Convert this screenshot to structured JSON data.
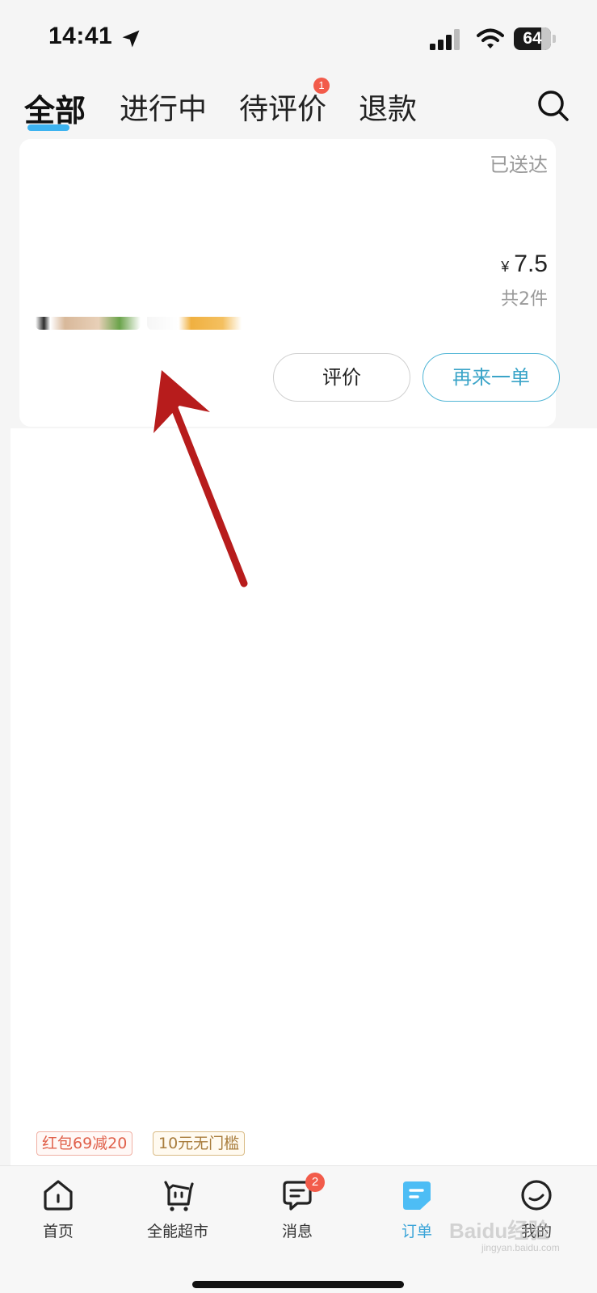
{
  "status_bar": {
    "time": "14:41",
    "battery": "64",
    "icons": [
      "location-arrow-icon",
      "signal-icon",
      "wifi-icon",
      "battery-icon"
    ]
  },
  "tabs": {
    "items": [
      {
        "label": "全部",
        "active": true
      },
      {
        "label": "进行中",
        "active": false
      },
      {
        "label": "待评价",
        "active": false,
        "badge": "1"
      },
      {
        "label": "退款",
        "active": false
      }
    ],
    "search_icon": "search-icon",
    "accent_color": "#3db3f0",
    "badge_color": "#f25b4a"
  },
  "order": {
    "status": "已送达",
    "price_symbol": "¥",
    "price": "7.5",
    "count": "共2件",
    "actions": {
      "review": "评价",
      "reorder": "再来一单"
    },
    "reorder_color": "#3aa4c8"
  },
  "annotation": {
    "type": "arrow",
    "color": "#b71c1c"
  },
  "coupons": [
    {
      "label": "红包69减20",
      "color": "#e0604a"
    },
    {
      "label": "10元无门槛",
      "color": "#a87c3c"
    }
  ],
  "bottom_nav": {
    "items": [
      {
        "label": "首页",
        "icon": "home-icon",
        "active": false
      },
      {
        "label": "全能超市",
        "icon": "supermarket-icon",
        "active": false
      },
      {
        "label": "消息",
        "icon": "message-icon",
        "active": false,
        "badge": "2"
      },
      {
        "label": "订单",
        "icon": "order-icon",
        "active": true
      },
      {
        "label": "我的",
        "icon": "profile-icon",
        "active": false
      }
    ],
    "active_color": "#3aa4d8"
  },
  "watermark": {
    "text": "Baidu经验",
    "sub": "jingyan.baidu.com"
  }
}
